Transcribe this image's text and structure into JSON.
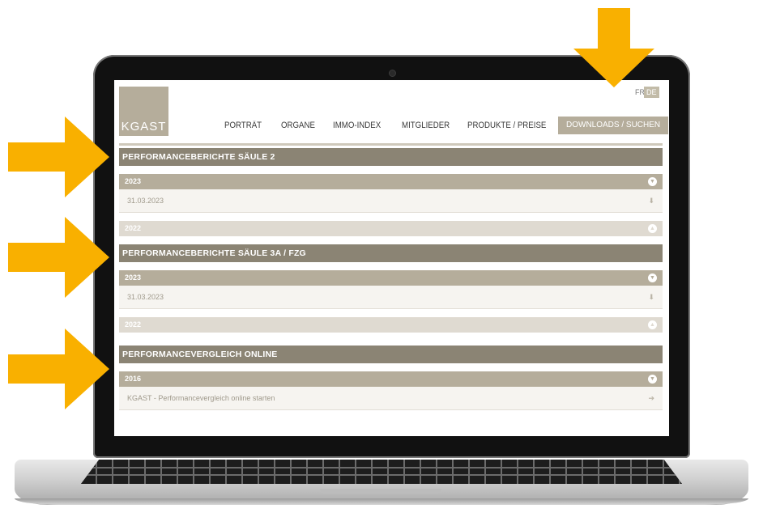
{
  "header": {
    "logo_text": "KGAST",
    "lang": {
      "fr": "FR",
      "de": "DE"
    },
    "nav": [
      {
        "label": "PORTRÄT"
      },
      {
        "label": "ORGANE"
      },
      {
        "label": "IMMO-INDEX"
      },
      {
        "label": "MITGLIEDER"
      },
      {
        "label": "PRODUKTE / PREISE"
      },
      {
        "label": "DOWNLOADS / SUCHEN",
        "active": true
      }
    ]
  },
  "sections": [
    {
      "title": "PERFORMANCEBERICHTE SÄULE 2",
      "groups": [
        {
          "year": "2023",
          "open": true,
          "items": [
            {
              "label": "31.03.2023",
              "icon": "download-icon"
            }
          ]
        },
        {
          "year": "2022",
          "open": false
        }
      ]
    },
    {
      "title": "PERFORMANCEBERICHTE SÄULE 3A / FZG",
      "groups": [
        {
          "year": "2023",
          "open": true,
          "items": [
            {
              "label": "31.03.2023",
              "icon": "download-icon"
            }
          ]
        },
        {
          "year": "2022",
          "open": false
        }
      ]
    },
    {
      "title": "PERFORMANCEVERGLEICH ONLINE",
      "groups": [
        {
          "year": "2016",
          "open": true,
          "items": [
            {
              "label": "KGAST - Performancevergleich online starten",
              "icon": "arrow-right-icon"
            }
          ]
        }
      ]
    }
  ],
  "colors": {
    "accent": "#b5ad9b",
    "section_bar": "#8b8474",
    "collapsed_bar": "#dfdad1",
    "arrow": "#f9b000"
  }
}
